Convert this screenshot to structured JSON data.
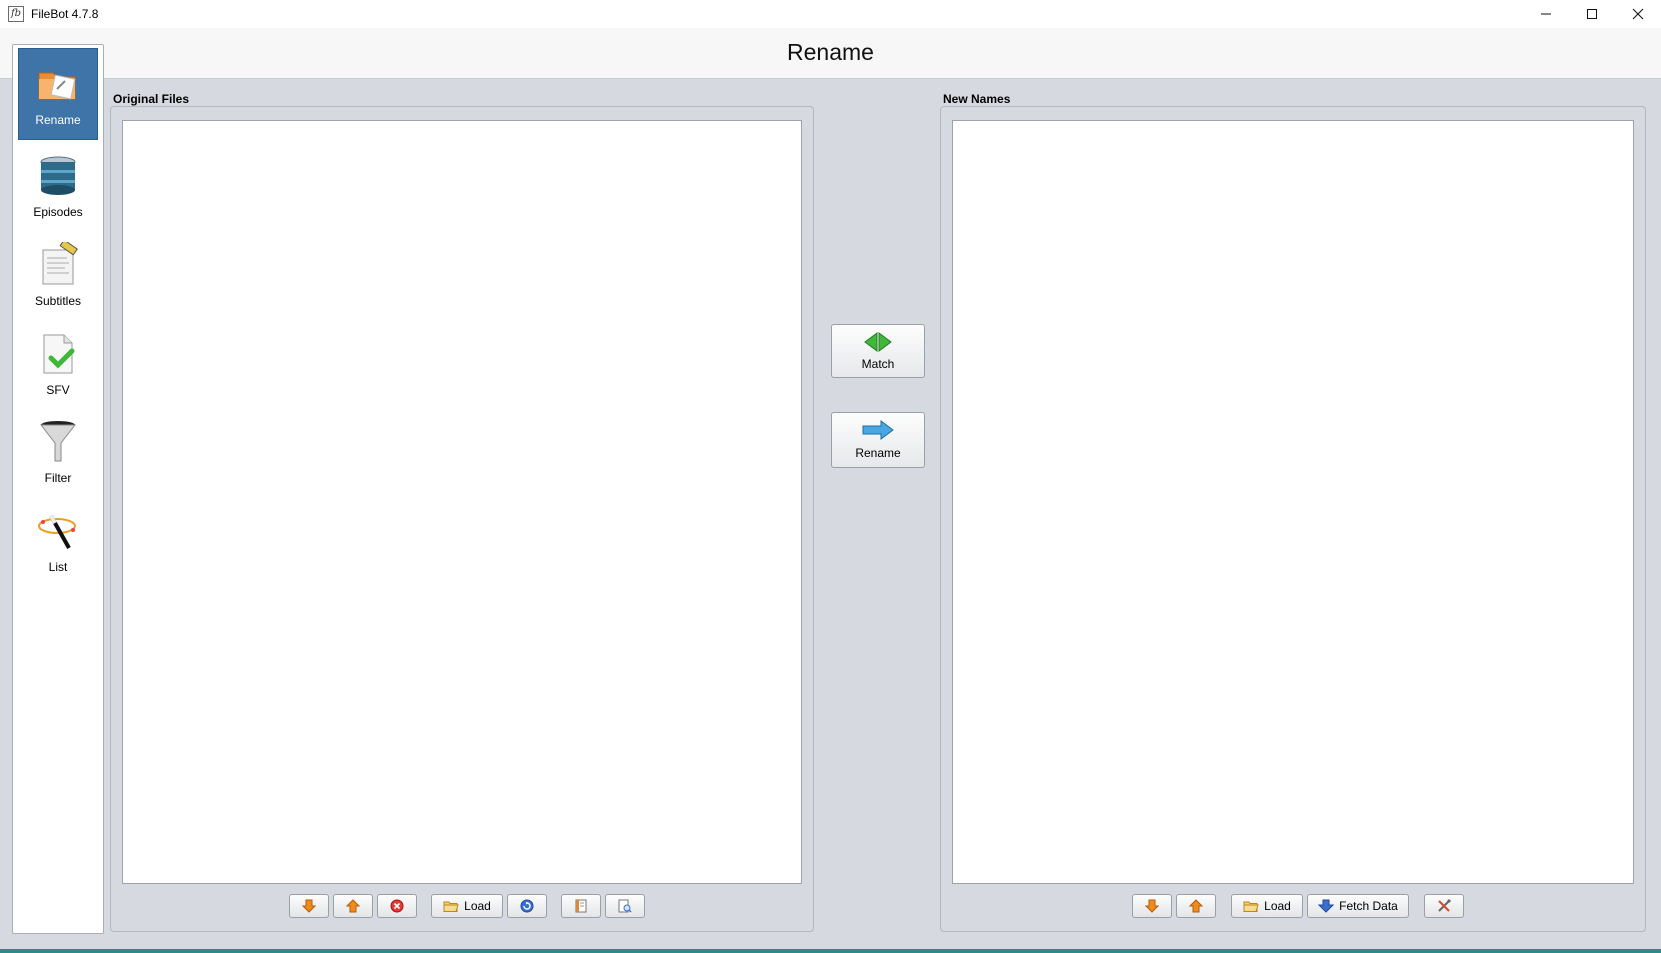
{
  "window": {
    "title": "FileBot 4.7.8",
    "app_icon_text": "fb",
    "minimize_icon": "minimize-icon",
    "maximize_icon": "maximize-icon",
    "close_icon": "close-icon"
  },
  "header": {
    "title": "Rename"
  },
  "sidebar": {
    "items": [
      {
        "label": "Rename",
        "icon": "rename-folder-icon",
        "active": true
      },
      {
        "label": "Episodes",
        "icon": "database-icon",
        "active": false
      },
      {
        "label": "Subtitles",
        "icon": "subtitles-icon",
        "active": false
      },
      {
        "label": "SFV",
        "icon": "checkmark-file-icon",
        "active": false
      },
      {
        "label": "Filter",
        "icon": "funnel-icon",
        "active": false
      },
      {
        "label": "List",
        "icon": "magic-wand-icon",
        "active": false
      }
    ]
  },
  "original_files": {
    "title": "Original Files",
    "toolbar": {
      "load_label": "Load"
    }
  },
  "actions": {
    "match_label": "Match",
    "rename_label": "Rename"
  },
  "new_names": {
    "title": "New Names",
    "toolbar": {
      "load_label": "Load",
      "fetch_label": "Fetch Data"
    }
  },
  "colors": {
    "accent": "#3f74a8",
    "background": "#d6d9df",
    "arrow_orange": "#f08a1c",
    "match_green": "#3fb83a",
    "rename_blue": "#4aa6e0"
  }
}
